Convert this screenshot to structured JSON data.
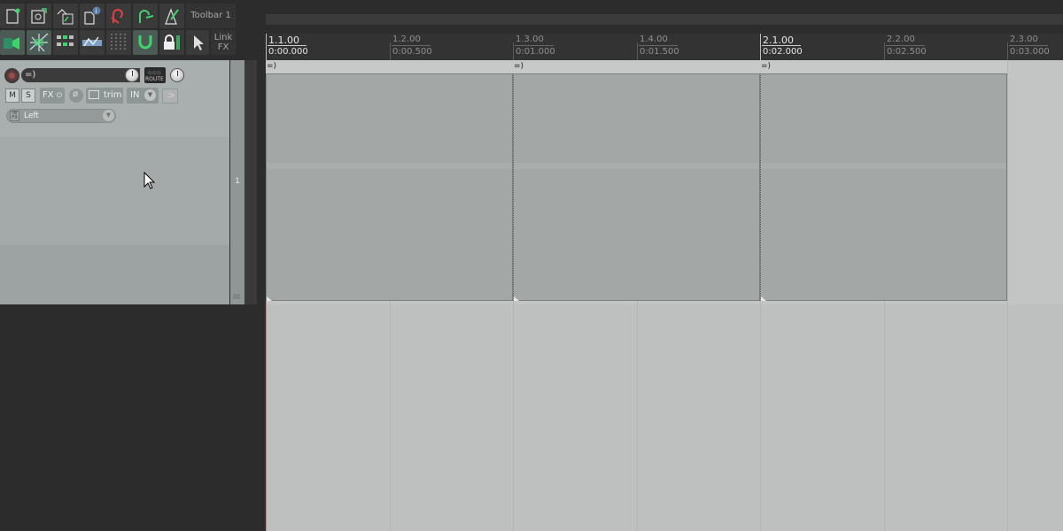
{
  "toolbar": {
    "title": "Toolbar 1",
    "link_fx": [
      "Link",
      "FX"
    ],
    "buttons_row1": [
      "new-project-icon",
      "save-project-icon",
      "project-settings-icon",
      "project-info-icon",
      "undo-icon",
      "redo-icon",
      "metronome-icon"
    ],
    "buttons_row2": [
      "ripple-edit-icon",
      "snap-grid-icon",
      "group-select-icon",
      "envelope-icon",
      "grid-lines-icon",
      "magnet-icon",
      "lock-icon",
      "cursor-icon"
    ]
  },
  "track": {
    "number": "1",
    "name": "=)",
    "route_label": "ROUTE",
    "mute": "M",
    "solo": "S",
    "fx": "FX",
    "trim": "trim",
    "input": "IN",
    "input_channel": "Left"
  },
  "ruler": {
    "markers": [
      {
        "bar": "1.1.00",
        "time": "0:00.000",
        "major": true
      },
      {
        "bar": "1.2.00",
        "time": "0:00.500",
        "major": false
      },
      {
        "bar": "1.3.00",
        "time": "0:01.000",
        "major": false
      },
      {
        "bar": "1.4.00",
        "time": "0:01.500",
        "major": false
      },
      {
        "bar": "2.1.00",
        "time": "0:02.000",
        "major": true
      },
      {
        "bar": "2.2.00",
        "time": "0:02.500",
        "major": false
      },
      {
        "bar": "2.3.00",
        "time": "0:03.000",
        "major": false
      }
    ]
  },
  "items": [
    {
      "label": "=)"
    },
    {
      "label": "=)"
    },
    {
      "label": "=)"
    }
  ],
  "colors": {
    "background": "#2c2c2c",
    "arrange": "#bdc0bf",
    "item": "#a3a8a7",
    "accent_green": "#3fd46a",
    "accent_red": "#e04040"
  }
}
